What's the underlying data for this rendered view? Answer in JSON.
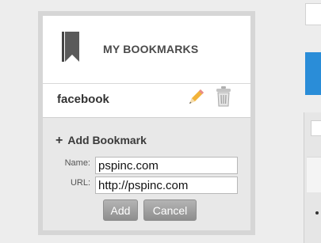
{
  "bookmarks": {
    "title": "MY BOOKMARKS",
    "items": [
      {
        "label": "facebook"
      }
    ]
  },
  "add_form": {
    "title": "Add Bookmark",
    "name_label": "Name:",
    "name_value": "pspinc.com",
    "url_label": "URL:",
    "url_value": "http://pspinc.com",
    "add_label": "Add",
    "cancel_label": "Cancel"
  },
  "icons": {
    "header": "bookmark-icon",
    "edit": "pencil-icon",
    "delete": "trash-icon",
    "add": "plus-icon"
  },
  "colors": {
    "accent_blue": "#2a8dd8",
    "button_grey": "#a0a0a0",
    "panel_border": "#d6d6d6"
  }
}
